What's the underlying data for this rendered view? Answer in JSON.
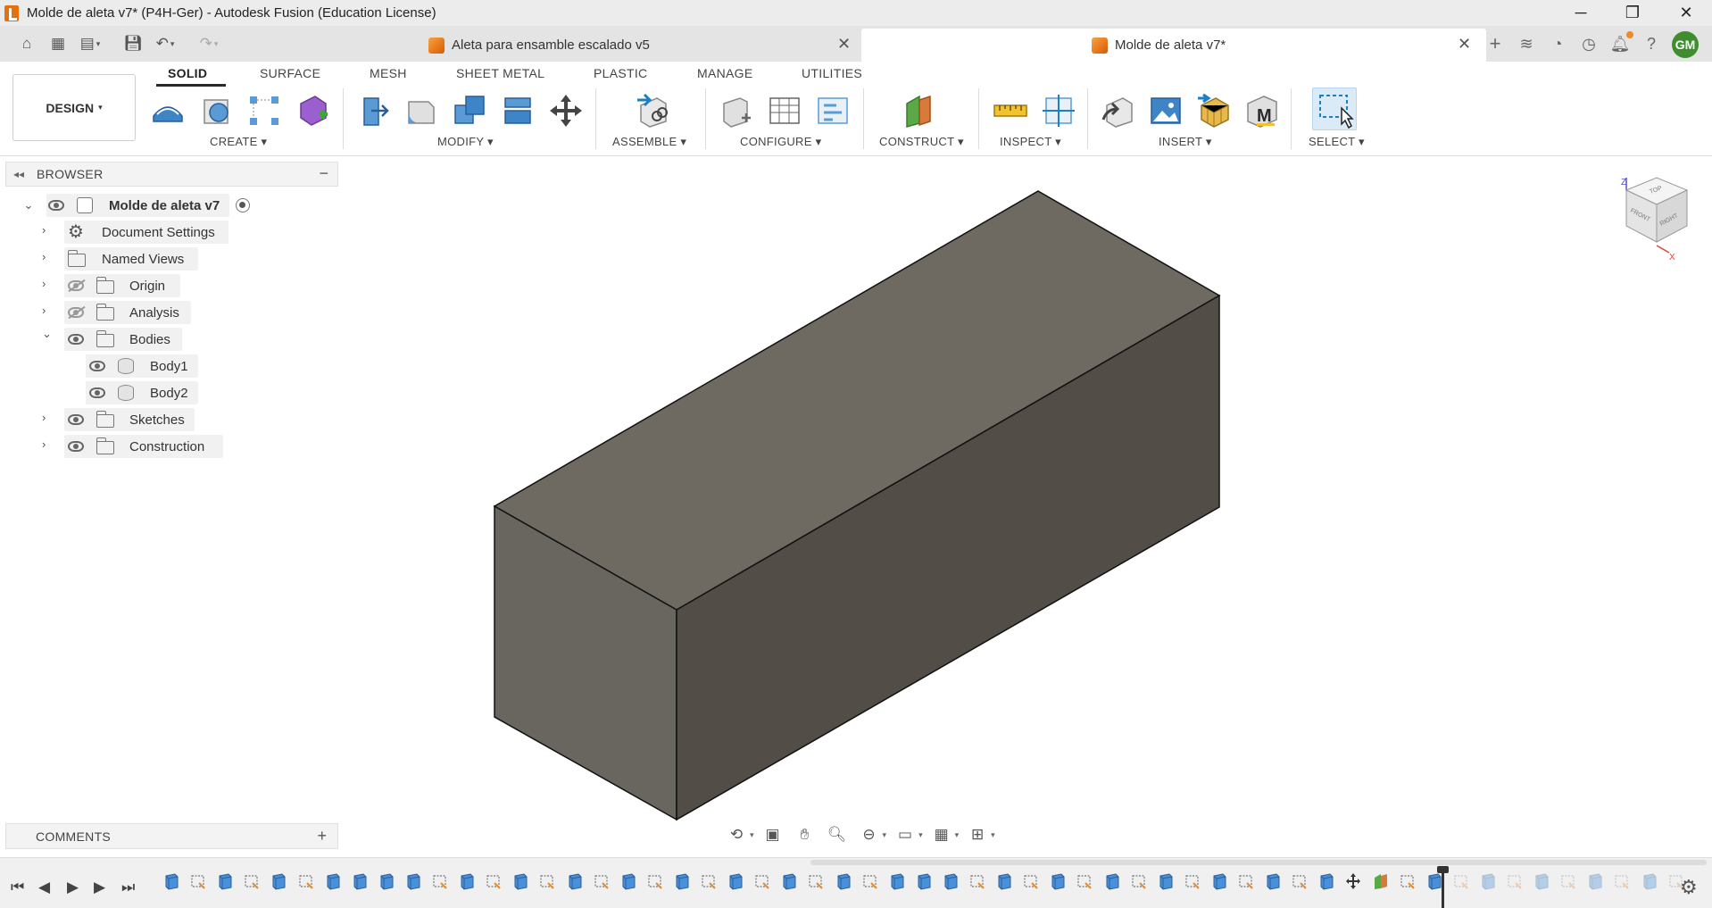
{
  "window": {
    "title": "Molde de aleta v7* (P4H-Ger) - Autodesk Fusion (Education License)",
    "controls": [
      "minimize",
      "restore",
      "close"
    ]
  },
  "tabs": [
    {
      "label": "Aleta para ensamble escalado v5",
      "active": false
    },
    {
      "label": "Molde de aleta v7*",
      "active": true
    }
  ],
  "user": {
    "initials": "GM",
    "avatar_color": "#3e8e2e"
  },
  "ribbon": {
    "workspace": "DESIGN",
    "tabs": [
      "SOLID",
      "SURFACE",
      "MESH",
      "SHEET METAL",
      "PLASTIC",
      "MANAGE",
      "UTILITIES"
    ],
    "active_tab": "SOLID",
    "groups": [
      "CREATE",
      "MODIFY",
      "ASSEMBLE",
      "CONFIGURE",
      "CONSTRUCT",
      "INSPECT",
      "INSERT",
      "SELECT"
    ]
  },
  "browser": {
    "title": "BROWSER",
    "root": "Molde de aleta v7",
    "items": [
      {
        "label": "Document Settings",
        "icon": "gear-icon"
      },
      {
        "label": "Named Views",
        "icon": "folder-icon"
      },
      {
        "label": "Origin",
        "icon": "folder-icon",
        "visible": false
      },
      {
        "label": "Analysis",
        "icon": "folder-icon",
        "visible": false
      },
      {
        "label": "Bodies",
        "icon": "folder-icon",
        "visible": true,
        "expanded": true
      },
      {
        "label": "Body1",
        "icon": "body-icon",
        "visible": true
      },
      {
        "label": "Body2",
        "icon": "body-icon",
        "visible": true
      },
      {
        "label": "Sketches",
        "icon": "folder-icon",
        "visible": true
      },
      {
        "label": "Construction",
        "icon": "folder-icon",
        "visible": true
      }
    ]
  },
  "comments": {
    "title": "COMMENTS"
  },
  "viewcube": {
    "top": "TOP",
    "front": "FRONT",
    "right": "RIGHT",
    "axis_z": "Z",
    "axis_x": "X"
  },
  "colors": {
    "accent": "#0696d7",
    "brand": "#e8700a",
    "model_top": "#6e6a62",
    "model_front": "#555049",
    "model_side": "#6a6862"
  }
}
